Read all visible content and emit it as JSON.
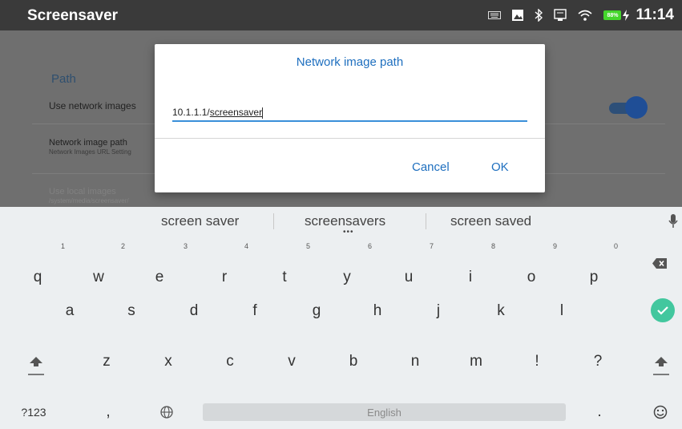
{
  "status_bar": {
    "title": "Screensaver",
    "battery": "88%",
    "time": "11:14"
  },
  "settings": {
    "section_header": "Path",
    "use_network_images": "Use network images",
    "network_image_path_title": "Network image path",
    "network_image_path_summary": "Network Images URL Setting",
    "use_local_images": "Use local images",
    "local_images_path": "/system/media/screensaver/",
    "toggle_on": true
  },
  "dialog": {
    "title": "Network image path",
    "input_prefix": "10.1.1.1/",
    "input_underlined": "screensaver",
    "cancel": "Cancel",
    "ok": "OK"
  },
  "keyboard": {
    "suggestions": [
      "screen saver",
      "screensavers",
      "screen saved"
    ],
    "row1": [
      "q",
      "w",
      "e",
      "r",
      "t",
      "y",
      "u",
      "i",
      "o",
      "p"
    ],
    "row1_hints": [
      "1",
      "2",
      "3",
      "4",
      "5",
      "6",
      "7",
      "8",
      "9",
      "0"
    ],
    "row2": [
      "a",
      "s",
      "d",
      "f",
      "g",
      "h",
      "j",
      "k",
      "l"
    ],
    "row3": [
      "z",
      "x",
      "c",
      "v",
      "b",
      "n",
      "m",
      "!",
      "?"
    ],
    "symbols_key": "?123",
    "comma": ",",
    "period": ".",
    "space_label": "English",
    "accent_color": "#42c79e"
  }
}
